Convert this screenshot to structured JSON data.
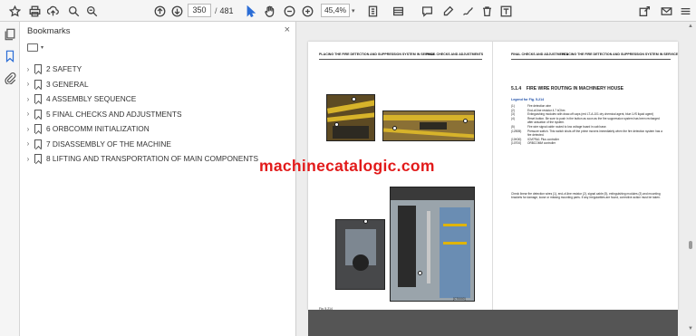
{
  "toolbar": {
    "current_page": "350",
    "page_separator": "/",
    "total_pages": "481",
    "zoom_value": "45,4%",
    "zoom_caret": "▾",
    "icons": [
      "bookmark-star-icon",
      "print-icon",
      "upload-icon",
      "search-icon",
      "page-up-icon",
      "page-down-icon",
      "pointer-icon",
      "hand-icon",
      "zoom-out-icon",
      "zoom-in-icon",
      "fit-page-icon",
      "scroll-mode-icon",
      "comment-icon",
      "highlight-icon",
      "draw-icon",
      "delete-icon",
      "text-icon",
      "share-icon",
      "email-icon",
      "more-icon"
    ]
  },
  "left_rail": {
    "icons": [
      "copy-pages-icon",
      "bookmarks-icon",
      "attachments-icon"
    ]
  },
  "bookmarks_panel": {
    "title": "Bookmarks",
    "close_glyph": "×",
    "options_caret": "▾",
    "items": [
      {
        "label": "2 SAFETY"
      },
      {
        "label": "3 GENERAL"
      },
      {
        "label": "4 ASSEMBLY SEQUENCE"
      },
      {
        "label": "5 FINAL CHECKS AND ADJUSTMENTS"
      },
      {
        "label": "6 ORBCOMM INITIALIZATION"
      },
      {
        "label": "7 DISASSEMBLY OF THE MACHINE"
      },
      {
        "label": "8 LIFTING AND TRANSPORTATION OF MAIN COMPONENTS"
      }
    ],
    "chevron": "›"
  },
  "document": {
    "left_page": {
      "header_left": "PLACING THE FIRE DETECTION AND SUPPRESSION SYSTEM IN SERVICE",
      "header_right": "FINAL CHECKS AND ADJUSTMENTS",
      "figure_caption": "Fig. 5-214",
      "figure_code": "[CT0000]",
      "callouts": [
        "1",
        "2",
        "3",
        "4",
        "5",
        "6",
        "7"
      ],
      "footer_left": "5 - 348",
      "footer_center": "Assembly Sequence"
    },
    "right_page": {
      "header_left": "FINAL CHECKS AND ADJUSTMENTS",
      "header_right": "PLACING THE FIRE DETECTION AND SUPPRESSION SYSTEM IN SERVICE",
      "section_number": "5.1.4",
      "section_title": "FIRE WIRE ROUTING IN MACHINERY HOUSE",
      "legend_title": "Legend for Fig. 5-214",
      "legend": [
        {
          "key": "(1)",
          "text": "Fire detection wire"
        },
        {
          "key": "(2)",
          "text": "End-of-line resistor 4.7 kOhm"
        },
        {
          "key": "(3)",
          "text": "Extinguishing modules with draw-off caps (red LT-A-101 dry chemical agent, blue LVS liquid agent)"
        },
        {
          "key": "(4)",
          "text": "Reset button. Be sure to push in the button as soon as the fire suppression system has been recharged after actuation of the system."
        },
        {
          "key": "(5)",
          "text": "Fire wire signal cable routed to low voltage board in cab base."
        },
        {
          "key": "(12B05)",
          "text": "Pressure switch. This switch shuts off the prime movers immediately when the fire detection system has a fire detected."
        },
        {
          "key": "(10K00)",
          "text": "ICM7RA1 Plus controller"
        },
        {
          "key": "(10T00)",
          "text": "ORBCOMM controller"
        }
      ],
      "check_text": "Check linear fire detection wires (1), end-of-line resistor (2), signal cable (5), extinguishing modules (3) and mounting brackets for damage, loose or missing mounting parts. If any irregularities are found, corrective action must be taken.",
      "footer_center": "Assembly Sequence",
      "footer_right": "5 - 349"
    }
  },
  "watermark": "machinecatalogic.com",
  "scrollbar": {
    "up": "▲",
    "down": "▼"
  }
}
